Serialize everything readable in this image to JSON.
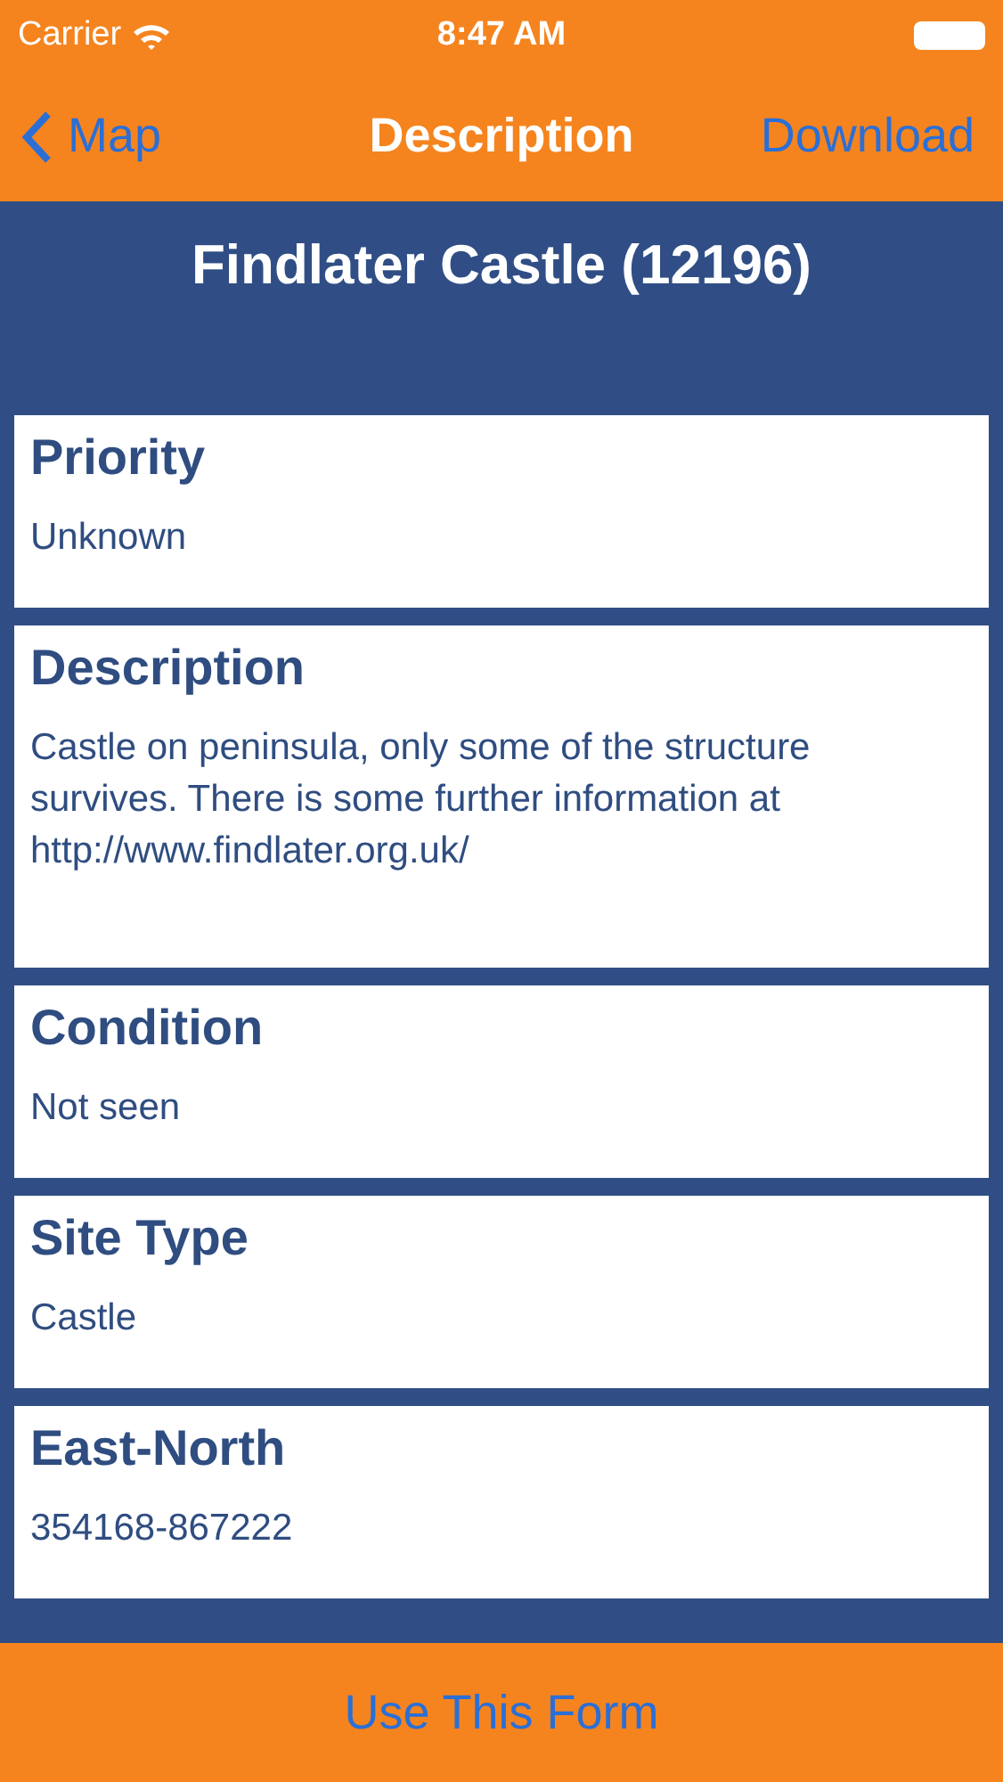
{
  "status_bar": {
    "carrier": "Carrier",
    "time": "8:47 AM"
  },
  "nav": {
    "back": "Map",
    "title": "Description",
    "action": "Download"
  },
  "title": "Findlater Castle (12196)",
  "fields": [
    {
      "label": "Priority",
      "value": "Unknown"
    },
    {
      "label": "Description",
      "value": "Castle on peninsula, only some of the structure survives. There is some further information at http://www.findlater.org.uk/"
    },
    {
      "label": "Condition",
      "value": "Not seen"
    },
    {
      "label": "Site Type",
      "value": "Castle"
    },
    {
      "label": "East-North",
      "value": "354168-867222"
    }
  ],
  "footer_button": "Use This Form"
}
